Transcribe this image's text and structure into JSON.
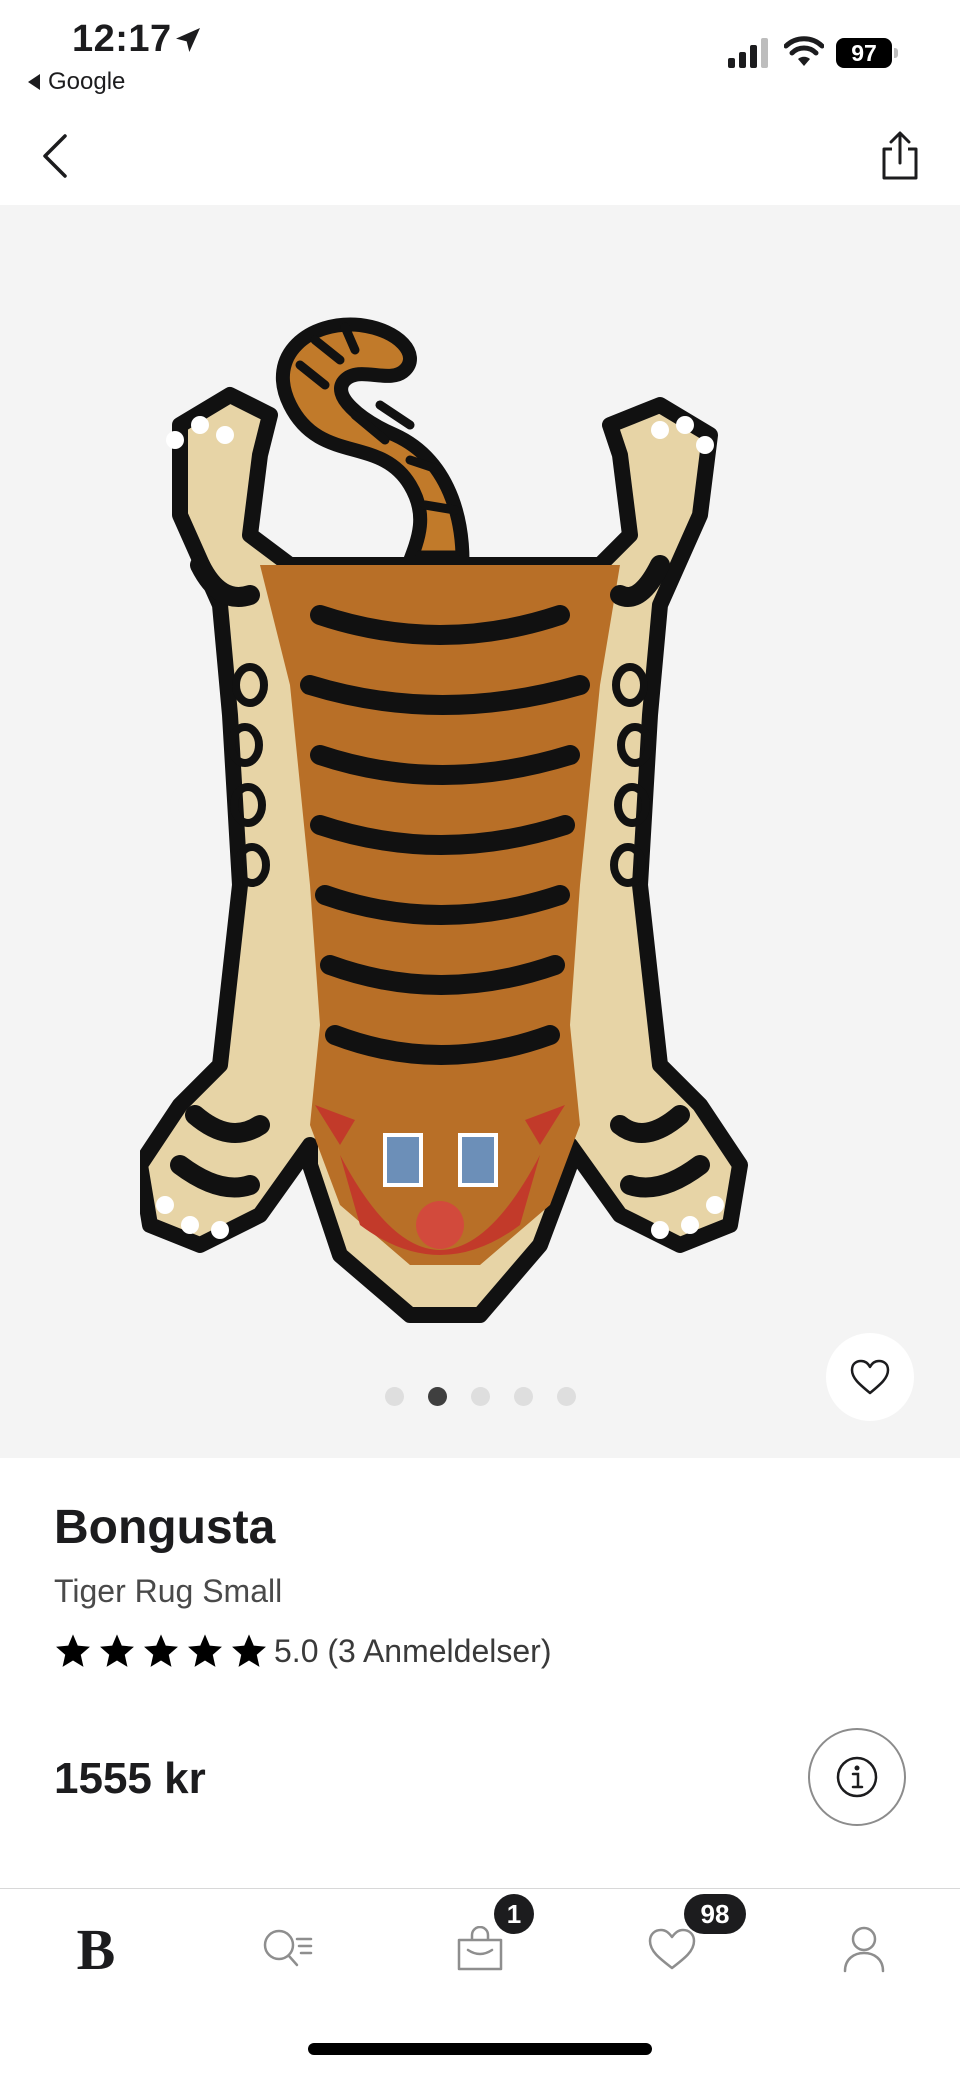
{
  "status_bar": {
    "time": "12:17",
    "back_app": "Google",
    "battery_level": "97"
  },
  "product": {
    "brand": "Bongusta",
    "name": "Tiger Rug Small",
    "rating_value": 5.0,
    "rating_text": "5.0 (3 Anmeldelser)",
    "price": "1555 kr",
    "image_count": 5,
    "active_image_index": 1
  },
  "tab_bar": {
    "home_logo": "B",
    "bag_badge": "1",
    "wishlist_badge": "98"
  },
  "colors": {
    "text": "#1c1c1e",
    "gallery_bg": "#f4f4f4",
    "dot_active": "#3f3f3f",
    "dot_inactive": "#dedede"
  },
  "icons": {
    "nav_back": "chevron-left-icon",
    "nav_share": "share-icon",
    "favorite": "heart-icon",
    "info": "info-icon",
    "search": "search-icon",
    "bag": "shopping-bag-icon",
    "wishlist": "heart-icon",
    "profile": "profile-icon"
  }
}
